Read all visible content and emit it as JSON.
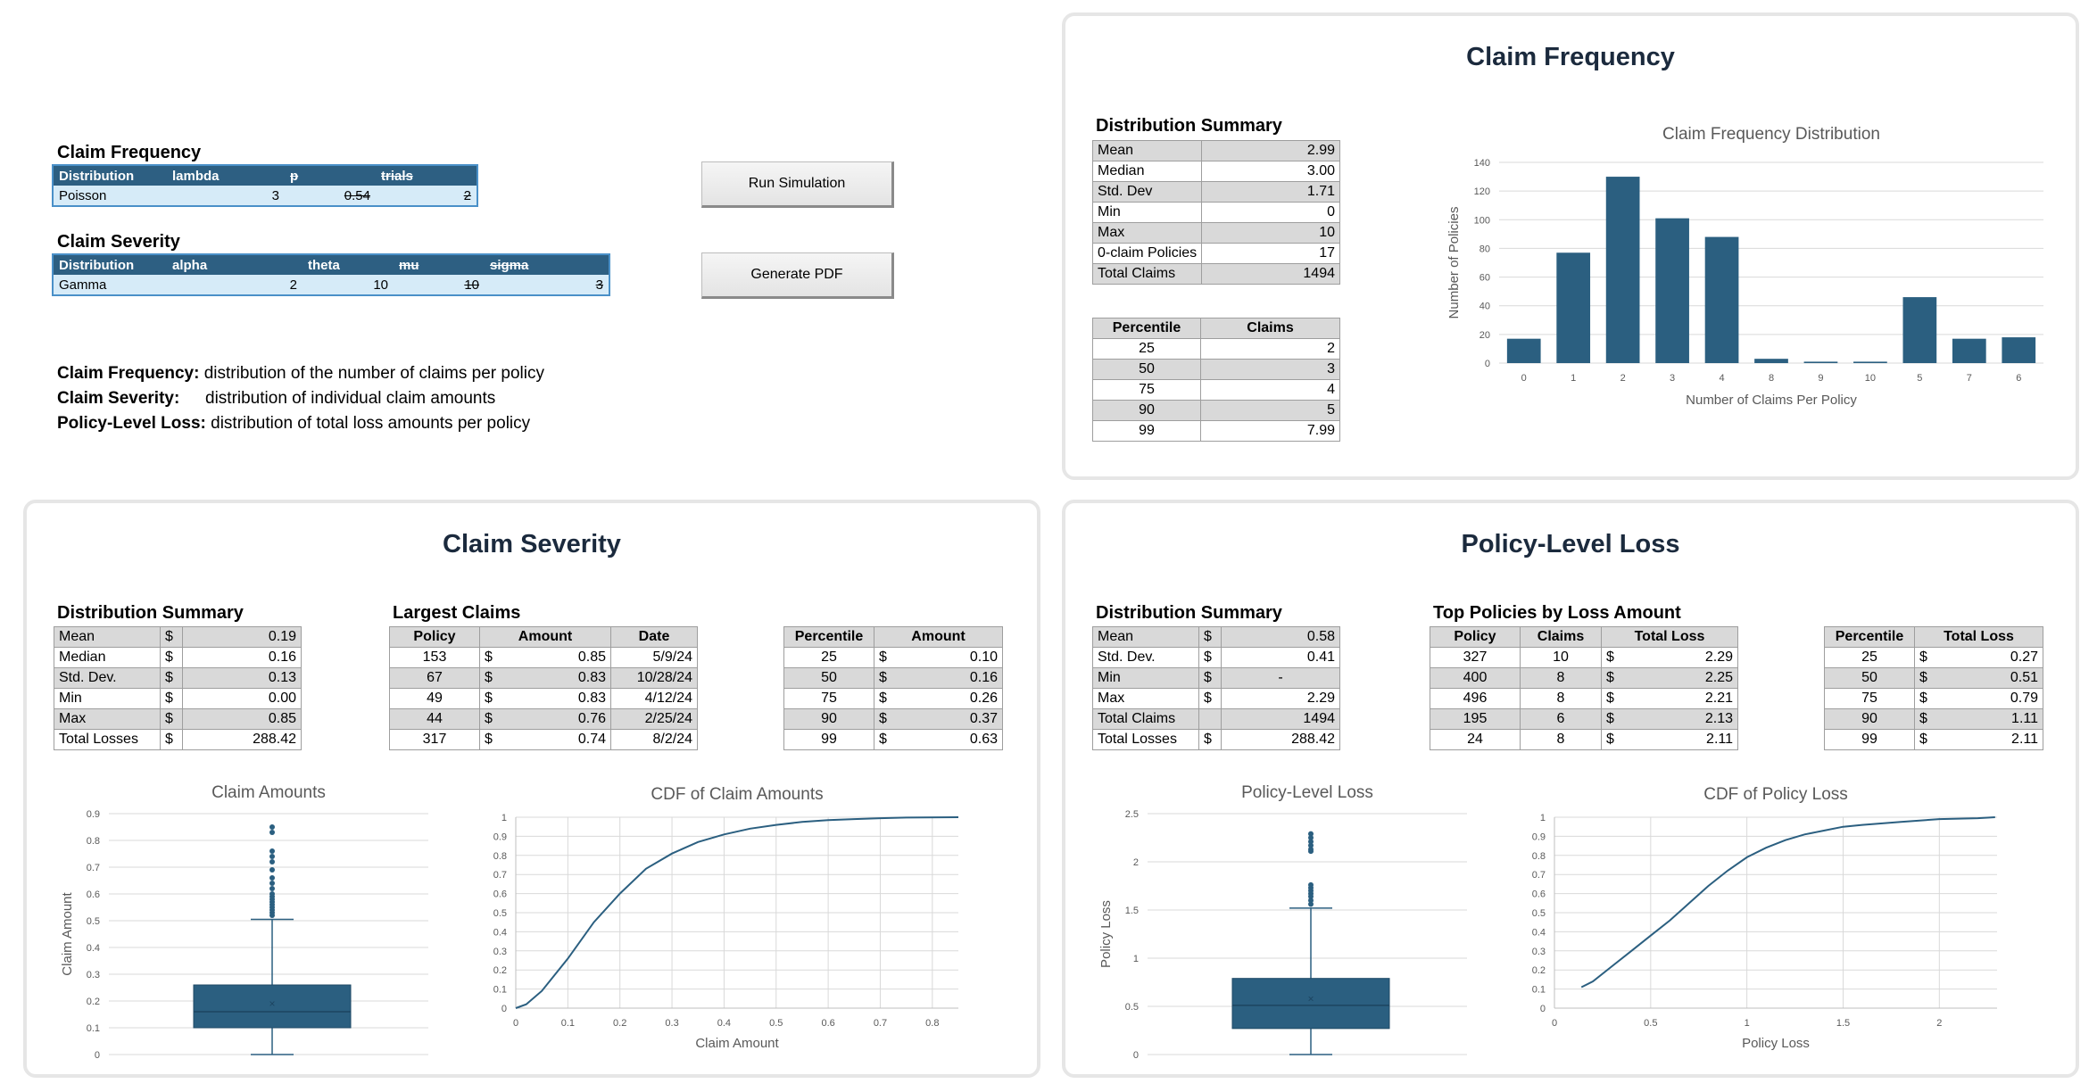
{
  "inputs": {
    "frequency": {
      "title": "Claim Frequency",
      "headers": [
        "Distribution",
        "lambda",
        "p",
        "trials"
      ],
      "row": [
        "Poisson",
        "3",
        "0.54",
        "2"
      ]
    },
    "severity": {
      "title": "Claim Severity",
      "headers": [
        "Distribution",
        "alpha",
        "theta",
        "mu",
        "sigma"
      ],
      "row": [
        "Gamma",
        "2",
        "10",
        "10",
        "3"
      ]
    }
  },
  "buttons": {
    "run": "Run Simulation",
    "pdf": "Generate PDF"
  },
  "descriptions": [
    {
      "term": "Claim Frequency:",
      "text": "distribution of the number of claims per policy"
    },
    {
      "term": "Claim Severity:",
      "text": "distribution of individual claim amounts"
    },
    {
      "term": "Policy-Level Loss:",
      "text": "distribution of total loss amounts per policy"
    }
  ],
  "frequency_panel": {
    "title": "Claim Frequency",
    "summary_title": "Distribution Summary",
    "summary": [
      [
        "Mean",
        "2.99"
      ],
      [
        "Median",
        "3.00"
      ],
      [
        "Std. Dev",
        "1.71"
      ],
      [
        "Min",
        "0"
      ],
      [
        "Max",
        "10"
      ],
      [
        "0-claim Policies",
        "17"
      ],
      [
        "Total Claims",
        "1494"
      ]
    ],
    "pct_headers": [
      "Percentile",
      "Claims"
    ],
    "percentiles": [
      [
        "25",
        "2"
      ],
      [
        "50",
        "3"
      ],
      [
        "75",
        "4"
      ],
      [
        "90",
        "5"
      ],
      [
        "99",
        "7.99"
      ]
    ]
  },
  "severity_panel": {
    "title": "Claim Severity",
    "summary_title": "Distribution Summary",
    "summary": [
      [
        "Mean",
        "$",
        "0.19"
      ],
      [
        "Median",
        "$",
        "0.16"
      ],
      [
        "Std. Dev.",
        "$",
        "0.13"
      ],
      [
        "Min",
        "$",
        "0.00"
      ],
      [
        "Max",
        "$",
        "0.85"
      ],
      [
        "Total Losses",
        "$",
        "288.42"
      ]
    ],
    "largest_title": "Largest Claims",
    "largest_headers": [
      "Policy",
      "Amount",
      "Date"
    ],
    "largest": [
      [
        "153",
        "$",
        "0.85",
        "5/9/24"
      ],
      [
        "67",
        "$",
        "0.83",
        "10/28/24"
      ],
      [
        "49",
        "$",
        "0.83",
        "4/12/24"
      ],
      [
        "44",
        "$",
        "0.76",
        "2/25/24"
      ],
      [
        "317",
        "$",
        "0.74",
        "8/2/24"
      ]
    ],
    "pct_headers": [
      "Percentile",
      "Amount"
    ],
    "percentiles": [
      [
        "25",
        "$",
        "0.10"
      ],
      [
        "50",
        "$",
        "0.16"
      ],
      [
        "75",
        "$",
        "0.26"
      ],
      [
        "90",
        "$",
        "0.37"
      ],
      [
        "99",
        "$",
        "0.63"
      ]
    ]
  },
  "loss_panel": {
    "title": "Policy-Level Loss",
    "summary_title": "Distribution Summary",
    "summary": [
      [
        "Mean",
        "$",
        "0.58"
      ],
      [
        "Std. Dev.",
        "$",
        "0.41"
      ],
      [
        "Min",
        "$",
        "-"
      ],
      [
        "Max",
        "$",
        "2.29"
      ],
      [
        "Total Claims",
        "",
        "1494"
      ],
      [
        "Total Losses",
        "$",
        "288.42"
      ]
    ],
    "top_title": "Top Policies by Loss Amount",
    "top_headers": [
      "Policy",
      "Claims",
      "Total Loss"
    ],
    "top": [
      [
        "327",
        "10",
        "$",
        "2.29"
      ],
      [
        "400",
        "8",
        "$",
        "2.25"
      ],
      [
        "496",
        "8",
        "$",
        "2.21"
      ],
      [
        "195",
        "6",
        "$",
        "2.13"
      ],
      [
        "24",
        "8",
        "$",
        "2.11"
      ]
    ],
    "pct_headers": [
      "Percentile",
      "Total Loss"
    ],
    "percentiles": [
      [
        "25",
        "$",
        "0.27"
      ],
      [
        "50",
        "$",
        "0.51"
      ],
      [
        "75",
        "$",
        "0.79"
      ],
      [
        "90",
        "$",
        "1.11"
      ],
      [
        "99",
        "$",
        "2.11"
      ]
    ]
  },
  "colors": {
    "series": "#2b5f80",
    "panel_border": "#e6e6e6",
    "title": "#1b2a3d"
  },
  "chart_data": [
    {
      "id": "freq",
      "type": "bar",
      "title": "Claim Frequency Distribution",
      "xlabel": "Number of Claims Per Policy",
      "ylabel": "Number of Policies",
      "categories": [
        "0",
        "1",
        "2",
        "3",
        "4",
        "8",
        "9",
        "10",
        "5",
        "7",
        "6"
      ],
      "values": [
        17,
        77,
        130,
        101,
        88,
        3,
        1,
        1,
        46,
        17,
        18
      ],
      "ylim": [
        0,
        140
      ],
      "yticks": [
        0,
        20,
        40,
        60,
        80,
        100,
        120,
        140
      ],
      "grid": true
    },
    {
      "id": "sevbox",
      "type": "box",
      "title": "Claim Amounts",
      "ylabel": "Claim Amount",
      "ylim": [
        0,
        0.9
      ],
      "yticks": [
        0,
        0.1,
        0.2,
        0.3,
        0.4,
        0.5,
        0.6,
        0.7,
        0.8,
        0.9
      ],
      "min": 0.0,
      "q1": 0.1,
      "median": 0.16,
      "mean": 0.19,
      "q3": 0.26,
      "whisker_high": 0.505,
      "outliers": [
        0.52,
        0.53,
        0.54,
        0.55,
        0.56,
        0.57,
        0.58,
        0.59,
        0.6,
        0.62,
        0.64,
        0.66,
        0.69,
        0.72,
        0.74,
        0.76,
        0.83,
        0.85
      ],
      "grid": true
    },
    {
      "id": "sevcdf",
      "type": "line",
      "title": "CDF of Claim Amounts",
      "xlabel": "Claim Amount",
      "ylabel": "",
      "xlim": [
        0,
        0.85
      ],
      "ylim": [
        0,
        1
      ],
      "xticks": [
        0,
        0.1,
        0.2,
        0.3,
        0.4,
        0.5,
        0.6,
        0.7,
        0.8
      ],
      "yticks": [
        0,
        0.1,
        0.2,
        0.3,
        0.4,
        0.5,
        0.6,
        0.7,
        0.8,
        0.9,
        1
      ],
      "x": [
        0,
        0.02,
        0.05,
        0.1,
        0.15,
        0.2,
        0.25,
        0.3,
        0.35,
        0.4,
        0.45,
        0.5,
        0.55,
        0.6,
        0.65,
        0.7,
        0.75,
        0.85
      ],
      "y": [
        0,
        0.02,
        0.09,
        0.26,
        0.45,
        0.6,
        0.73,
        0.81,
        0.87,
        0.91,
        0.94,
        0.96,
        0.975,
        0.985,
        0.99,
        0.995,
        0.998,
        1
      ],
      "grid": true
    },
    {
      "id": "lossbox",
      "type": "box",
      "title": "Policy-Level Loss",
      "ylabel": "Policy Loss",
      "ylim": [
        0,
        2.5
      ],
      "yticks": [
        0,
        0.5,
        1,
        1.5,
        2,
        2.5
      ],
      "min": 0.0,
      "q1": 0.27,
      "median": 0.51,
      "mean": 0.58,
      "q3": 0.79,
      "whisker_high": 1.52,
      "outliers": [
        1.56,
        1.6,
        1.64,
        1.67,
        1.7,
        1.73,
        1.76,
        2.11,
        2.13,
        2.17,
        2.21,
        2.25,
        2.29
      ],
      "grid": true
    },
    {
      "id": "losscdf",
      "type": "line",
      "title": "CDF of Policy Loss",
      "xlabel": "Policy Loss",
      "ylabel": "",
      "xlim": [
        0,
        2.3
      ],
      "ylim": [
        0,
        1
      ],
      "xticks": [
        0,
        0.5,
        1,
        1.5,
        2
      ],
      "yticks": [
        0,
        0.1,
        0.2,
        0.3,
        0.4,
        0.5,
        0.6,
        0.7,
        0.8,
        0.9,
        1
      ],
      "x": [
        0.14,
        0.2,
        0.3,
        0.4,
        0.5,
        0.6,
        0.7,
        0.8,
        0.9,
        1.0,
        1.1,
        1.2,
        1.3,
        1.4,
        1.5,
        1.6,
        1.8,
        2.0,
        2.2,
        2.29
      ],
      "y": [
        0.11,
        0.14,
        0.22,
        0.3,
        0.38,
        0.46,
        0.55,
        0.64,
        0.72,
        0.79,
        0.84,
        0.88,
        0.91,
        0.93,
        0.95,
        0.96,
        0.975,
        0.99,
        0.995,
        1
      ],
      "grid": true
    }
  ]
}
